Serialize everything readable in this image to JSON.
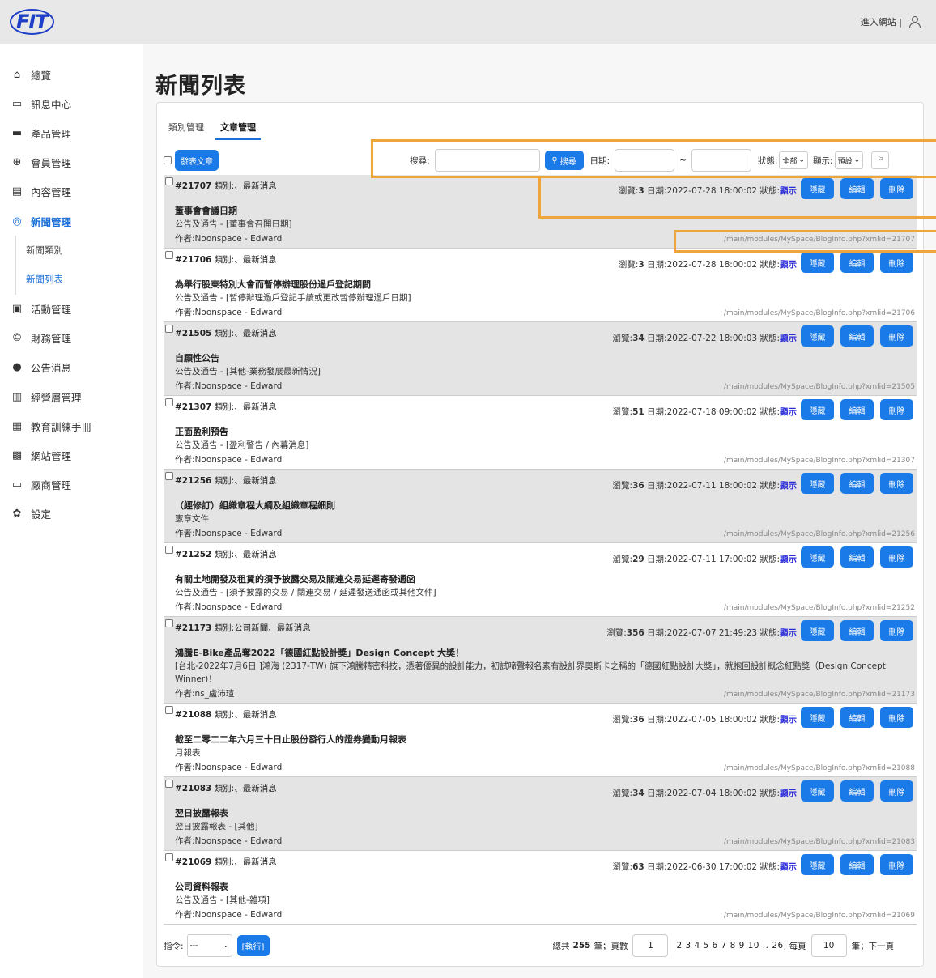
{
  "topbar": {
    "logo": "FIT",
    "enter_site": "進入網站 |"
  },
  "sidebar": [
    {
      "label": "總覽",
      "icon": "home-icon"
    },
    {
      "label": "訊息中心",
      "icon": "message-icon"
    },
    {
      "label": "產品管理",
      "icon": "briefcase-icon"
    },
    {
      "label": "會員管理",
      "icon": "member-icon"
    },
    {
      "label": "內容管理",
      "icon": "document-icon"
    },
    {
      "label": "新聞管理",
      "icon": "globe-icon"
    },
    {
      "label": "新聞類別",
      "icon": ""
    },
    {
      "label": "新聞列表",
      "icon": ""
    },
    {
      "label": "活動管理",
      "icon": "calendar-check-icon"
    },
    {
      "label": "財務管理",
      "icon": "copyright-icon"
    },
    {
      "label": "公告消息",
      "icon": "info-icon"
    },
    {
      "label": "經營層管理",
      "icon": "id-card-icon"
    },
    {
      "label": "教育訓練手冊",
      "icon": "list-icon"
    },
    {
      "label": "網站管理",
      "icon": "store-icon"
    },
    {
      "label": "廠商管理",
      "icon": "archive-icon"
    },
    {
      "label": "設定",
      "icon": "gear-icon"
    }
  ],
  "page_title": "新聞列表",
  "tabs": [
    "類別管理",
    "文章管理"
  ],
  "toolbar": {
    "publish_label": "發表文章",
    "search_label": "搜尋:",
    "search_button": "搜尋",
    "date_label": "日期:",
    "date_sep": "~",
    "status_label": "狀態:",
    "status_value": "全部",
    "display_label": "顯示:",
    "display_value": "預設"
  },
  "row_labels": {
    "views": "瀏覽:",
    "date": "日期:",
    "status": "狀態:",
    "hide": "隱藏",
    "edit": "編輯",
    "delete": "刪除"
  },
  "rows": [
    {
      "id": "#21707",
      "category": "類別:、最新消息",
      "views": "3",
      "date": "2022-07-28 18:00:02",
      "status": "顯示",
      "title": "董事會會議日期",
      "desc": "公告及通告 - [董事會召開日期]",
      "author": "作者:Noonspace - Edward",
      "link": "/main/modules/MySpace/BlogInfo.php?xmlid=21707"
    },
    {
      "id": "#21706",
      "category": "類別:、最新消息",
      "views": "3",
      "date": "2022-07-28 18:00:02",
      "status": "顯示",
      "title": "為舉行股東特別大會而暫停辦理股份過戶登記期間",
      "desc": "公告及通告 - [暫停辦理過戶登記手續或更改暫停辦理過戶日期]",
      "author": "作者:Noonspace - Edward",
      "link": "/main/modules/MySpace/BlogInfo.php?xmlid=21706"
    },
    {
      "id": "#21505",
      "category": "類別:、最新消息",
      "views": "34",
      "date": "2022-07-22 18:00:03",
      "status": "顯示",
      "title": "自願性公告",
      "desc": "公告及通告 - [其他-業務發展最新情況]",
      "author": "作者:Noonspace - Edward",
      "link": "/main/modules/MySpace/BlogInfo.php?xmlid=21505"
    },
    {
      "id": "#21307",
      "category": "類別:、最新消息",
      "views": "51",
      "date": "2022-07-18 09:00:02",
      "status": "顯示",
      "title": "正面盈利預告",
      "desc": "公告及通告 - [盈利警告 / 內幕消息]",
      "author": "作者:Noonspace - Edward",
      "link": "/main/modules/MySpace/BlogInfo.php?xmlid=21307"
    },
    {
      "id": "#21256",
      "category": "類別:、最新消息",
      "views": "36",
      "date": "2022-07-11 18:00:02",
      "status": "顯示",
      "title": "（經修訂）組織章程大綱及組織章程細則",
      "desc": "憲章文件",
      "author": "作者:Noonspace - Edward",
      "link": "/main/modules/MySpace/BlogInfo.php?xmlid=21256"
    },
    {
      "id": "#21252",
      "category": "類別:、最新消息",
      "views": "29",
      "date": "2022-07-11 17:00:02",
      "status": "顯示",
      "title": "有關土地開發及租賃的須予披露交易及關連交易延遲寄發通函",
      "desc": "公告及通告 - [須予披露的交易 / 關連交易 / 延遲發送通函或其他文件]",
      "author": "作者:Noonspace - Edward",
      "link": "/main/modules/MySpace/BlogInfo.php?xmlid=21252"
    },
    {
      "id": "#21173",
      "category": "類別:公司新聞、最新消息",
      "views": "356",
      "date": "2022-07-07 21:49:23",
      "status": "顯示",
      "title": "鴻騰E-Bike產品奪2022「德國紅點設計獎」Design Concept 大獎！",
      "desc": "[台北-2022年7月6日 ]鴻海 (2317-TW) 旗下鴻騰精密科技，憑著優異的設計能力，初試啼聲報名素有設計界奧斯卡之稱的「德國紅點設計大獎」，就抱回設計概念紅點獎（Design Concept Winner)！",
      "author": "作者:ns_盧沛瑄",
      "link": "/main/modules/MySpace/BlogInfo.php?xmlid=21173"
    },
    {
      "id": "#21088",
      "category": "類別:、最新消息",
      "views": "36",
      "date": "2022-07-05 18:00:02",
      "status": "顯示",
      "title": "截至二零二二年六月三十日止股份發行人的證券變動月報表",
      "desc": "月報表",
      "author": "作者:Noonspace - Edward",
      "link": "/main/modules/MySpace/BlogInfo.php?xmlid=21088"
    },
    {
      "id": "#21083",
      "category": "類別:、最新消息",
      "views": "34",
      "date": "2022-07-04 18:00:02",
      "status": "顯示",
      "title": "翌日披露報表",
      "desc": "翌日披露報表 - [其他]",
      "author": "作者:Noonspace - Edward",
      "link": "/main/modules/MySpace/BlogInfo.php?xmlid=21083"
    },
    {
      "id": "#21069",
      "category": "類別:、最新消息",
      "views": "63",
      "date": "2022-06-30 17:00:02",
      "status": "顯示",
      "title": "公司資料報表",
      "desc": "公告及通告 - [其他-雜項]",
      "author": "作者:Noonspace - Edward",
      "link": "/main/modules/MySpace/BlogInfo.php?xmlid=21069"
    }
  ],
  "footer": {
    "command_label": "指令:",
    "command_value": "---",
    "execute": "[執行]",
    "total_text": "總共",
    "total": "255",
    "unit_page": "筆；頁數",
    "page_value": "1",
    "pages": "2 3 4 5 6 7 8 9 10 .. 26",
    "per_page_label": "; 每頁",
    "per_page_value": "10",
    "next_label": "筆；下一頁"
  },
  "colors": {
    "accent": "#1a7ae8",
    "highlight": "#f0a43c",
    "status_show": "#2b2bd8"
  }
}
